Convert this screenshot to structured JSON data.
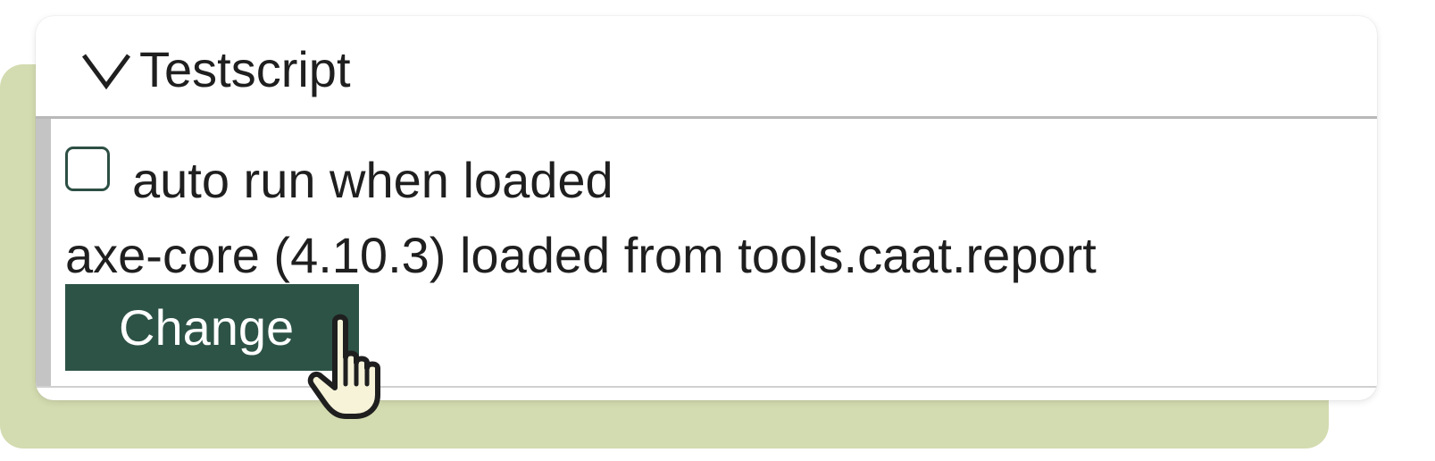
{
  "colors": {
    "backdrop": "#d3dbb0",
    "button_bg": "#2d5346",
    "button_text": "#ffffff",
    "checkbox_border": "#2d4f44",
    "cursor_fill": "#f6f3d9"
  },
  "panel": {
    "toggle_icon": "chevron-down-icon",
    "title": "Testscript",
    "expanded": true
  },
  "options": {
    "auto_run": {
      "label": "auto run when loaded",
      "checked": false
    }
  },
  "status": {
    "text": "axe-core (4.10.3) loaded from tools.caat.report"
  },
  "actions": {
    "change_label": "Change"
  },
  "cursor": {
    "icon": "hand-pointer-icon"
  }
}
